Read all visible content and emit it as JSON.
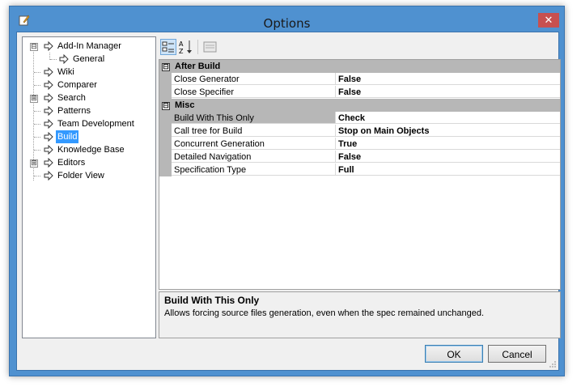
{
  "window": {
    "title": "Options"
  },
  "tree": {
    "items": [
      {
        "label": "Add-In Manager",
        "expander": "⊟",
        "level": 0
      },
      {
        "label": "General",
        "level": 1
      },
      {
        "label": "Wiki",
        "level": 0
      },
      {
        "label": "Comparer",
        "level": 0
      },
      {
        "label": "Search",
        "expander": "⊞",
        "level": 0
      },
      {
        "label": "Patterns",
        "level": 0
      },
      {
        "label": "Team Development",
        "level": 0
      },
      {
        "label": "Build",
        "level": 0,
        "selected": true
      },
      {
        "label": "Knowledge Base",
        "level": 0
      },
      {
        "label": "Editors",
        "expander": "⊞",
        "level": 0
      },
      {
        "label": "Folder View",
        "level": 0
      }
    ]
  },
  "toolbar": {
    "categorized_icon": "categorized-icon",
    "alphabetical_icon": "sort-alphabetical-icon",
    "property_pages_icon": "property-pages-icon"
  },
  "grid": {
    "categories": [
      {
        "name": "After Build",
        "toggle": "⊟",
        "properties": [
          {
            "name": "Close Generator",
            "value": "False"
          },
          {
            "name": "Close Specifier",
            "value": "False"
          }
        ]
      },
      {
        "name": "Misc",
        "toggle": "⊟",
        "properties": [
          {
            "name": "Build With This Only",
            "value": "Check",
            "selected": true
          },
          {
            "name": "Call tree for Build",
            "value": "Stop on Main Objects"
          },
          {
            "name": "Concurrent Generation",
            "value": "True"
          },
          {
            "name": "Detailed Navigation",
            "value": "False"
          },
          {
            "name": "Specification Type",
            "value": "Full"
          }
        ]
      }
    ]
  },
  "help": {
    "title": "Build With This Only",
    "description": "Allows forcing source files generation, even when the spec remained unchanged."
  },
  "buttons": {
    "ok": "OK",
    "cancel": "Cancel"
  },
  "colors": {
    "title_bar": "#4f91d0",
    "close_button": "#c75050",
    "selection": "#3399ff",
    "category_band": "#b7b7b7"
  }
}
